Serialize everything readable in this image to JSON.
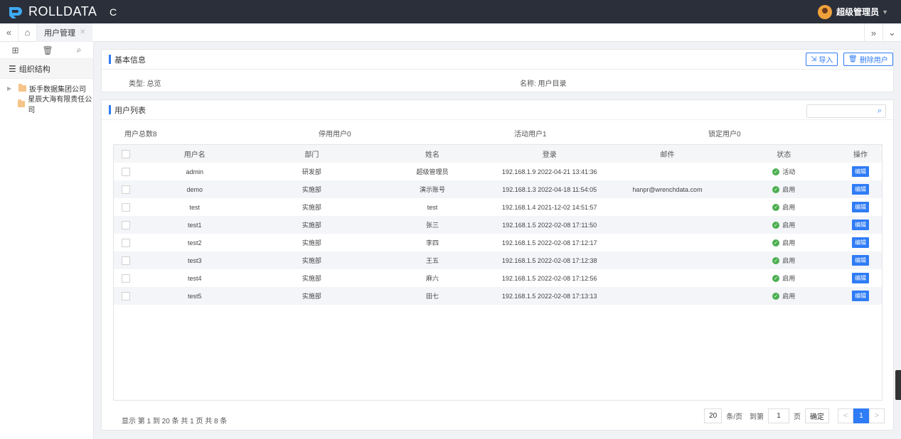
{
  "app": {
    "brand": "ROLLDATA",
    "user_name": "超级管理员"
  },
  "tabs": {
    "active_label": "用户管理"
  },
  "sidebar": {
    "section_title": "组织结构",
    "nodes": [
      {
        "label": "扳手数据集团公司",
        "expandable": true
      },
      {
        "label": "星辰大海有限责任公司",
        "expandable": false
      }
    ]
  },
  "basic_info": {
    "title": "基本信息",
    "import_label": "导入",
    "delete_label": "删除用户",
    "type_label": "类型: 总览",
    "name_label": "名称: 用户目录"
  },
  "user_list": {
    "title": "用户列表",
    "search_placeholder": "",
    "stats": {
      "total": "用户总数8",
      "disabled": "停用用户0",
      "active": "活动用户1",
      "locked": "锁定用户0"
    },
    "columns": [
      "用户名",
      "部门",
      "姓名",
      "登录",
      "邮件",
      "状态",
      "操作"
    ],
    "rows": [
      {
        "username": "admin",
        "dept": "研发部",
        "name": "超级管理员",
        "login": "192.168.1.9 2022-04-21 13:41:36",
        "email": "",
        "status": "活动",
        "action": "编辑"
      },
      {
        "username": "demo",
        "dept": "实施部",
        "name": "演示账号",
        "login": "192.168.1.3 2022-04-18 11:54:05",
        "email": "hanpr@wrenchdata.com",
        "status": "启用",
        "action": "编辑"
      },
      {
        "username": "test",
        "dept": "实施部",
        "name": "test",
        "login": "192.168.1.4 2021-12-02 14:51:57",
        "email": "",
        "status": "启用",
        "action": "编辑"
      },
      {
        "username": "test1",
        "dept": "实施部",
        "name": "张三",
        "login": "192.168.1.5 2022-02-08 17:11:50",
        "email": "",
        "status": "启用",
        "action": "编辑"
      },
      {
        "username": "test2",
        "dept": "实施部",
        "name": "李四",
        "login": "192.168.1.5 2022-02-08 17:12:17",
        "email": "",
        "status": "启用",
        "action": "编辑"
      },
      {
        "username": "test3",
        "dept": "实施部",
        "name": "王五",
        "login": "192.168.1.5 2022-02-08 17:12:38",
        "email": "",
        "status": "启用",
        "action": "编辑"
      },
      {
        "username": "test4",
        "dept": "实施部",
        "name": "麻六",
        "login": "192.168.1.5 2022-02-08 17:12:56",
        "email": "",
        "status": "启用",
        "action": "编辑"
      },
      {
        "username": "test5",
        "dept": "实施部",
        "name": "田七",
        "login": "192.168.1.5 2022-02-08 17:13:13",
        "email": "",
        "status": "启用",
        "action": "编辑"
      }
    ],
    "footer_info": "显示 第 1 到 20 条 共 1 页 共 8 条",
    "pagination": {
      "page_size": "20",
      "per_page_label": "条/页",
      "goto_label": "到第",
      "goto_value": "1",
      "page_suffix": "页",
      "confirm_label": "确定",
      "prev": "<",
      "current": "1",
      "next": ">"
    }
  },
  "colors": {
    "accent": "#2f7cf6",
    "topbar": "#2b2f3a",
    "status_ok": "#4caf50"
  }
}
